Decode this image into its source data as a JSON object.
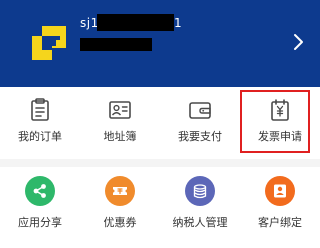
{
  "profile": {
    "name_prefix": "sj1",
    "name_suffix": "1"
  },
  "icons": {
    "avatar": "yellow-pixel-logo-icon",
    "chevron": "chevron-right-icon"
  },
  "colors": {
    "header_bg": "#0d3a8e",
    "logo": "#f5d51c",
    "highlight": "#e02020",
    "share": "#2eb86a",
    "coupon": "#f08b2c",
    "taxpayer": "#5c67b8",
    "customer": "#f26b1d"
  },
  "menu_row1": [
    {
      "label": "我的订单",
      "icon": "order-list-icon"
    },
    {
      "label": "地址簿",
      "icon": "address-card-icon"
    },
    {
      "label": "我要支付",
      "icon": "wallet-icon"
    },
    {
      "label": "发票申请",
      "icon": "invoice-icon"
    }
  ],
  "menu_row2": [
    {
      "label": "应用分享",
      "icon": "share-icon"
    },
    {
      "label": "优惠券",
      "icon": "coupon-icon"
    },
    {
      "label": "纳税人管理",
      "icon": "coins-icon"
    },
    {
      "label": "客户绑定",
      "icon": "customer-icon"
    }
  ]
}
